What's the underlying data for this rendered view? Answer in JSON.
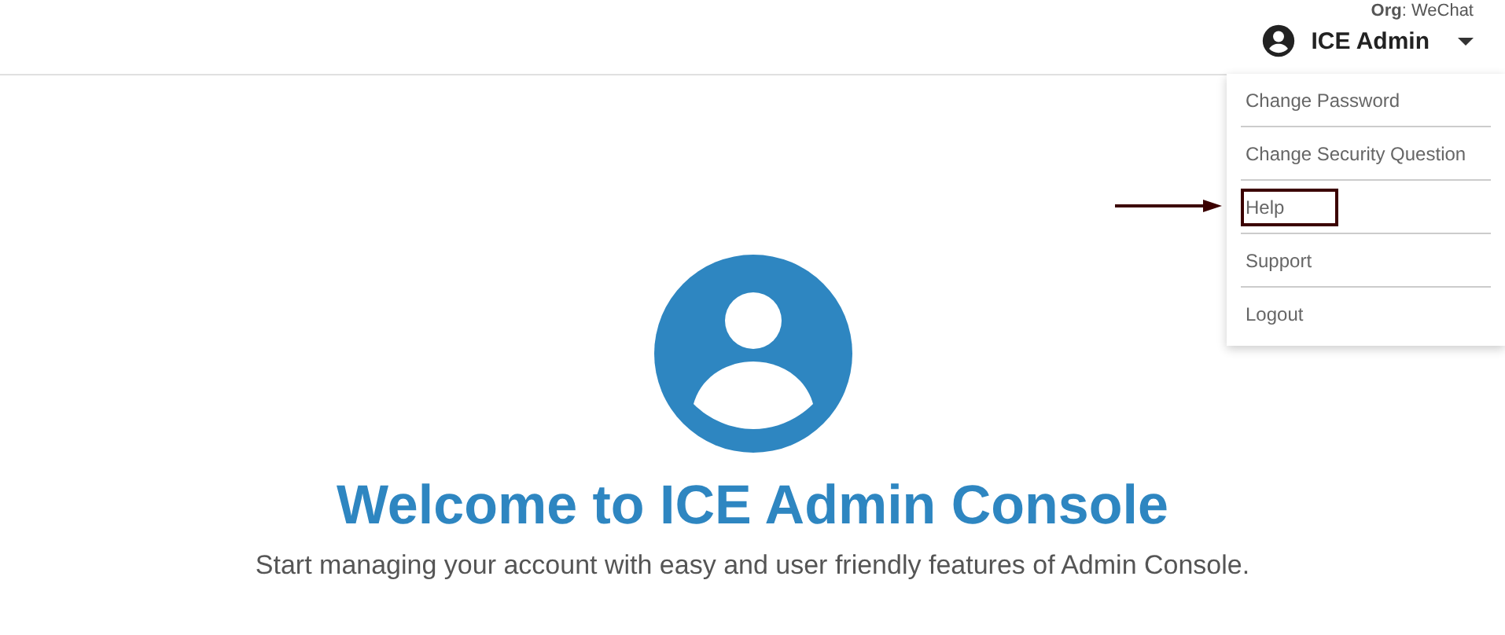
{
  "header": {
    "org": "**Org**: WeChat",
    "user": {
      "name": "ICE Admin",
      "menu_open": true
    }
  },
  "user_menu": [
    {
      "label": "Change Password",
      "highlighted": false
    },
    {
      "label": "Change Security Question",
      "highlighted": false
    },
    {
      "label": "Help",
      "highlighted": true
    },
    {
      "label": "Support",
      "highlighted": false
    },
    {
      "label": "Logout",
      "highlighted": false
    }
  ],
  "welcome": {
    "title": "Welcome to ICE Admin Console",
    "subtitle": "Start managing your account with easy and user friendly features of Admin Console."
  }
}
